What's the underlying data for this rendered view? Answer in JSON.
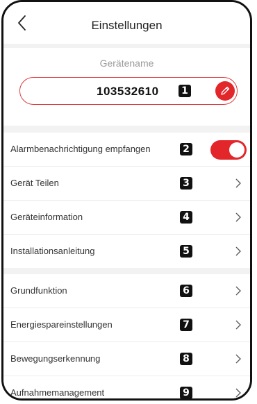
{
  "header": {
    "title": "Einstellungen",
    "back_icon": "chevron-left-icon"
  },
  "device_name": {
    "label": "Gerätename",
    "value": "103532610",
    "badge": "1",
    "edit_icon": "pencil-icon"
  },
  "settings": [
    {
      "label": "Alarmbenachrichtigung empfangen",
      "badge": "2",
      "control": "toggle",
      "enabled": true
    },
    {
      "label": "Gerät Teilen",
      "badge": "3",
      "control": "chevron"
    },
    {
      "label": "Geräteinformation",
      "badge": "4",
      "control": "chevron"
    },
    {
      "label": "Installationsanleitung",
      "badge": "5",
      "control": "chevron"
    }
  ],
  "functions": [
    {
      "label": "Grundfunktion",
      "badge": "6",
      "control": "chevron"
    },
    {
      "label": "Energiesparеinstellungen",
      "badge": "7",
      "control": "chevron"
    },
    {
      "label": "Bewegungserkennung",
      "badge": "8",
      "control": "chevron"
    },
    {
      "label": "Aufnahmemanagement",
      "badge": "9",
      "control": "chevron"
    }
  ],
  "colors": {
    "accent": "#e2262a",
    "background": "#f2f2f2",
    "label_gray": "#9a9a9a"
  }
}
